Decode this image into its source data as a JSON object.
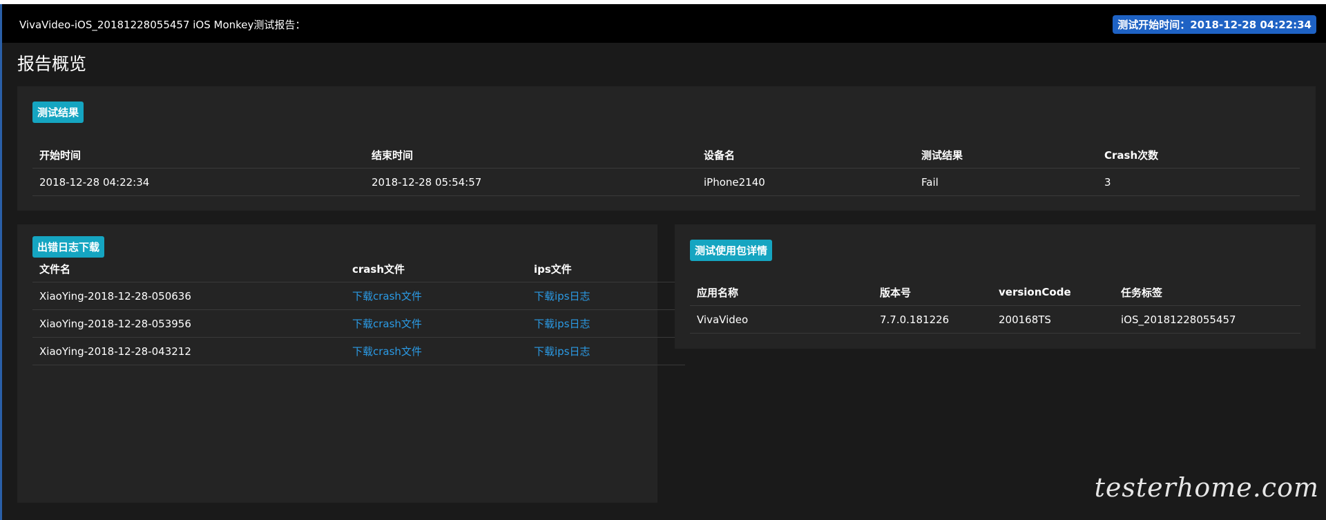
{
  "header": {
    "title": "VivaVideo-iOS_20181228055457 iOS Monkey测试报告：",
    "start_time_badge": "测试开始时间：2018-12-28 04:22:34"
  },
  "page_title": "报告概览",
  "test_result": {
    "label": "测试结果",
    "columns": [
      "开始时间",
      "结束时间",
      "设备名",
      "测试结果",
      "Crash次数"
    ],
    "row": {
      "start_time": "2018-12-28 04:22:34",
      "end_time": "2018-12-28 05:54:57",
      "device": "iPhone2140",
      "result": "Fail",
      "crash_count": "3"
    },
    "colors": {
      "fail": "#d62b2b"
    }
  },
  "error_logs": {
    "label": "出错日志下载",
    "columns": [
      "文件名",
      "crash文件",
      "ips文件"
    ],
    "rows": [
      {
        "file": "XiaoYing-2018-12-28-050636",
        "crash": "下载crash文件",
        "ips": "下载ips日志"
      },
      {
        "file": "XiaoYing-2018-12-28-053956",
        "crash": "下载crash文件",
        "ips": "下载ips日志"
      },
      {
        "file": "XiaoYing-2018-12-28-043212",
        "crash": "下载crash文件",
        "ips": "下载ips日志"
      }
    ]
  },
  "package_details": {
    "label": "测试使用包详情",
    "columns": [
      "应用名称",
      "版本号",
      "versionCode",
      "任务标签"
    ],
    "row": {
      "app_name": "VivaVideo",
      "version": "7.7.0.181226",
      "version_code": "200168TS",
      "task_tag": "iOS_20181228055457"
    }
  },
  "watermark": "testerhome.com",
  "colors": {
    "badge": "#15a5c1",
    "start_badge": "#1e62c4",
    "link": "#2b9be6",
    "background": "#1a1a1a",
    "panel": "#242424"
  }
}
